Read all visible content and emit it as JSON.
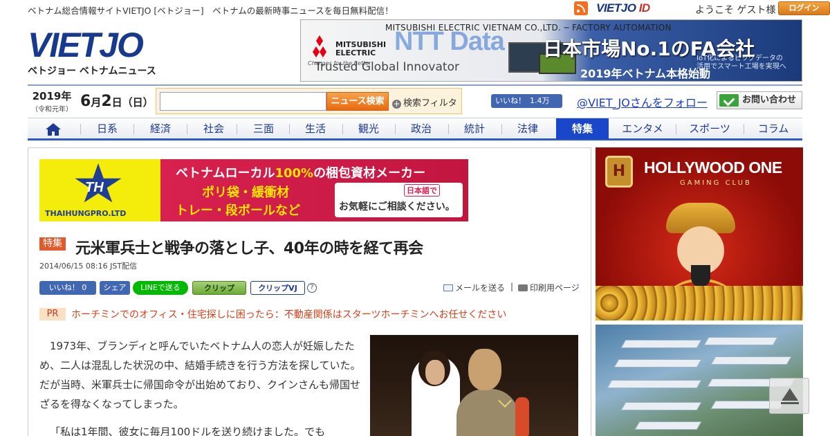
{
  "site": {
    "tagline": "ベトナム総合情報サイトVIETJO [ベトジョー]　ベトナムの最新時事ニュースを毎日無料配信！",
    "vietjo_id_main": "VIETJO",
    "vietjo_id_suffix": "ID",
    "welcome": "ようこそ ゲスト様",
    "login_label": "ログイン",
    "logo_word": "VIETJO",
    "logo_sub": "ベトジョー ベトナムニュース"
  },
  "header_ad": {
    "company": "MITSUBISHI ELECTRIC VIETNAM CO.,LTD. ─ FACTORY AUTOMATION",
    "brand": "MITSUBISHI ELECTRIC",
    "brand_slogan": "Changes for the Better",
    "trusted": "Trusted Global Innovator",
    "ntt": "NTT Data",
    "headline": "日本市場No.1のFA会社",
    "subline": "IoT化によるビッグデータの\n活用でスマート工場を実現へ",
    "year_line": "2019年ベトナム本格始動"
  },
  "date": {
    "year": "2019年",
    "era": "（令和元年）",
    "month": "6",
    "month_suffix": "月",
    "day": "2",
    "day_suffix": "日（日）"
  },
  "search": {
    "placeholder": "",
    "button": "ニュース検索",
    "filter_icon": "+",
    "filter": "検索フィルタ"
  },
  "social_header": {
    "like": "いいね！",
    "like_count": "1.4万",
    "follow": "@VIET_JOさんをフォロー",
    "contact": "お問い合わせ"
  },
  "nav": {
    "items": [
      "日系",
      "経済",
      "社会",
      "三面",
      "生活",
      "観光",
      "政治",
      "統計",
      "法律",
      "特集",
      "エンタメ",
      "スポーツ",
      "コラム"
    ],
    "active": "特集"
  },
  "banner": {
    "th_logo": "TH",
    "company": "THAIHUNGPRO.LTD",
    "line1_a": "ベトナムローカル",
    "line1_b": "100%",
    "line1_c": "の梱包資材メーカー",
    "line2": "ポリ袋・緩衝材",
    "line3": "トレー・段ボールなど",
    "chip_a": "日本語で",
    "chip_b": "お気軽にご相談ください。"
  },
  "article": {
    "tag": "特集",
    "title": "元米軍兵士と戦争の落とし子、40年の時を経て再会",
    "date": "2014/06/15 08:16 JST配信",
    "fb_like": "いいね！ 0",
    "share": "シェア",
    "line": "LINEで送る",
    "clip1": "クリップ",
    "clip2": "クリップVJ",
    "help": "?",
    "mail": "メールを送る",
    "separator": "|",
    "print": "印刷用ページ",
    "pr_label": "PR",
    "pr_text": "ホーチミンでのオフィス・住宅探しに困ったら：不動産関係はスターツホーチミンへお任せください",
    "paragraphs": [
      "1973年、ブランディと呼んでいたベトナム人の恋人が妊娠したため、二人は混乱した状況の中、結婚手続きを行う方法を探していた。だが当時、米軍兵士に帰国命令が出始めており、クインさんも帰国せざるを得なくなってしまった。",
      "「私は1年間、彼女に毎月100ドルを送り続けました。でも"
    ]
  },
  "sidebar": {
    "ad1_title": "HOLLYWOOD ONE",
    "ad1_sub": "GAMING CLUB",
    "ad1_logo": "H"
  },
  "colors": {
    "brand_blue": "#173a8f",
    "nav_active": "#1a47c9",
    "accent_orange": "#e86a10",
    "tag_red": "#e15a2b"
  }
}
